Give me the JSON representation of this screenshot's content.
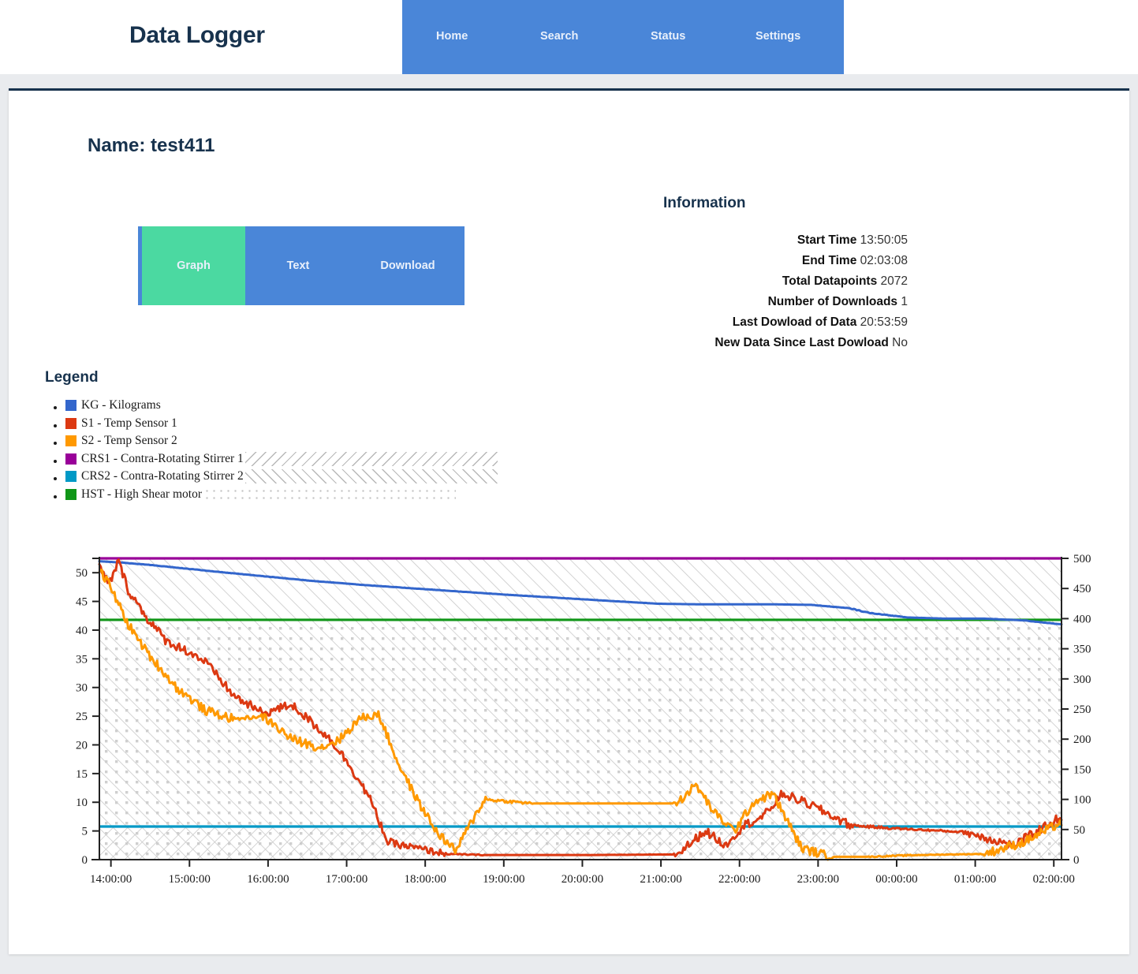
{
  "navbar": {
    "brand": "Data Logger",
    "links": [
      {
        "label": "Home"
      },
      {
        "label": "Search"
      },
      {
        "label": "Status"
      },
      {
        "label": "Settings"
      }
    ],
    "nav_bg": "#4a86d8"
  },
  "page": {
    "title": "Name: test411",
    "heading_color": "#17324d",
    "background": "#e9ebee",
    "card_background": "#ffffff"
  },
  "buttons": {
    "graph": "Graph",
    "text": "Text",
    "download": "Download",
    "active_color": "#4bd9a1",
    "inactive_color": "#4a86d8"
  },
  "information": {
    "heading": "Information",
    "rows": [
      {
        "label": "Start Time",
        "value": "13:50:05"
      },
      {
        "label": "End Time",
        "value": "02:03:08"
      },
      {
        "label": "Total Datapoints",
        "value": "2072"
      },
      {
        "label": "Number of Downloads",
        "value": "1"
      },
      {
        "label": "Last Dowload of Data",
        "value": "20:53:59"
      },
      {
        "label": "New Data Since Last Dowload",
        "value": "No"
      }
    ]
  },
  "legend": {
    "heading": "Legend",
    "items": [
      {
        "label": "KG - Kilograms",
        "color": "#3366cc",
        "hatch": "none"
      },
      {
        "label": "S1 - Temp Sensor 1",
        "color": "#dc3912",
        "hatch": "none"
      },
      {
        "label": "S2 - Temp Sensor 2",
        "color": "#ff9900",
        "hatch": "none"
      },
      {
        "label": "CRS1 - Contra-Rotating Stirrer 1",
        "color": "#990099",
        "hatch": "backslash"
      },
      {
        "label": "CRS2 - Contra-Rotating Stirrer 2",
        "color": "#0099c6",
        "hatch": "forwardslash"
      },
      {
        "label": "HST - High Shear motor",
        "color": "#109618",
        "hatch": "dots"
      }
    ]
  },
  "chart_data": {
    "type": "line",
    "title": "",
    "xlabel": "",
    "ylabel": "",
    "grid": false,
    "legend_position": "external-above",
    "x_ticks": [
      "14:00:00",
      "15:00:00",
      "16:00:00",
      "17:00:00",
      "18:00:00",
      "19:00:00",
      "20:00:00",
      "21:00:00",
      "22:00:00",
      "23:00:00",
      "00:00:00",
      "01:00:00",
      "02:00:00"
    ],
    "xlim_label": [
      "13:50:05",
      "02:03:08"
    ],
    "left_axis": {
      "label": "",
      "ylim": [
        0,
        52.5
      ],
      "ticks": [
        0,
        5,
        10,
        15,
        20,
        25,
        30,
        35,
        40,
        45,
        50
      ]
    },
    "right_axis": {
      "label": "",
      "ylim": [
        0,
        500
      ],
      "ticks": [
        0,
        50,
        100,
        150,
        200,
        250,
        300,
        350,
        400,
        450,
        500
      ]
    },
    "series": [
      {
        "name": "KG - Kilograms",
        "key": "KG",
        "color": "#3366cc",
        "axis": "left",
        "x": [
          0,
          0.02,
          0.05,
          0.08,
          0.12,
          0.17,
          0.22,
          0.28,
          0.35,
          0.42,
          0.5,
          0.58,
          0.62,
          0.66,
          0.7,
          0.74,
          0.78,
          0.8,
          0.84,
          0.88,
          0.92,
          0.96,
          1.0
        ],
        "values": [
          52.0,
          51.8,
          51.4,
          50.9,
          50.2,
          49.4,
          48.6,
          47.8,
          47.0,
          46.2,
          45.4,
          44.6,
          44.5,
          44.5,
          44.5,
          44.4,
          43.8,
          43.0,
          42.2,
          42.0,
          42.0,
          41.7,
          41.0
        ]
      },
      {
        "name": "S1 - Temp Sensor 1",
        "key": "S1",
        "color": "#dc3912",
        "axis": "left",
        "x": [
          0,
          0.01,
          0.02,
          0.03,
          0.05,
          0.07,
          0.09,
          0.11,
          0.14,
          0.17,
          0.2,
          0.22,
          0.24,
          0.26,
          0.28,
          0.3,
          0.33,
          0.36,
          0.4,
          0.45,
          0.5,
          0.6,
          0.63,
          0.65,
          0.67,
          0.69,
          0.71,
          0.74,
          0.78,
          0.82,
          0.9,
          0.95,
          1.0
        ],
        "values": [
          51.0,
          48.0,
          52.0,
          47.0,
          42.0,
          38.0,
          36.5,
          34.5,
          28.5,
          25.5,
          27.0,
          24.0,
          21.0,
          16.5,
          11.0,
          3.0,
          2.0,
          1.0,
          0.8,
          0.8,
          0.8,
          0.9,
          5.0,
          2.5,
          6.0,
          7.5,
          11.5,
          9.5,
          6.0,
          5.5,
          4.8,
          2.5,
          7.5
        ]
      },
      {
        "name": "S2 - Temp Sensor 2",
        "key": "S2",
        "color": "#ff9900",
        "axis": "left",
        "x": [
          0,
          0.01,
          0.03,
          0.05,
          0.08,
          0.11,
          0.14,
          0.17,
          0.2,
          0.23,
          0.25,
          0.27,
          0.29,
          0.31,
          0.33,
          0.35,
          0.37,
          0.4,
          0.45,
          0.5,
          0.55,
          0.6,
          0.62,
          0.64,
          0.66,
          0.68,
          0.7,
          0.73,
          0.76,
          0.8,
          0.85,
          0.92,
          0.96,
          1.0
        ],
        "values": [
          50.5,
          48.0,
          41.0,
          36.0,
          30.0,
          26.0,
          24.5,
          25.0,
          21.0,
          19.5,
          21.0,
          24.5,
          25.5,
          17.0,
          10.5,
          5.0,
          1.5,
          10.5,
          9.8,
          9.8,
          9.8,
          9.8,
          13.0,
          8.0,
          5.0,
          10.0,
          11.5,
          2.0,
          0.5,
          0.5,
          0.8,
          1.0,
          3.0,
          6.5
        ]
      },
      {
        "name": "CRS1 - Contra-Rotating Stirrer 1",
        "key": "CRS1",
        "color": "#990099",
        "axis": "right",
        "constant": 500,
        "x": [
          0,
          1
        ],
        "values": [
          500,
          500
        ]
      },
      {
        "name": "CRS2 - Contra-Rotating Stirrer 2",
        "key": "CRS2",
        "color": "#0099c6",
        "axis": "right",
        "constant": 55,
        "x": [
          0,
          1
        ],
        "values": [
          55,
          55
        ]
      },
      {
        "name": "HST - High Shear motor",
        "key": "HST",
        "color": "#109618",
        "axis": "right",
        "constant": 398,
        "x": [
          0,
          1
        ],
        "values": [
          398,
          398
        ]
      }
    ]
  }
}
